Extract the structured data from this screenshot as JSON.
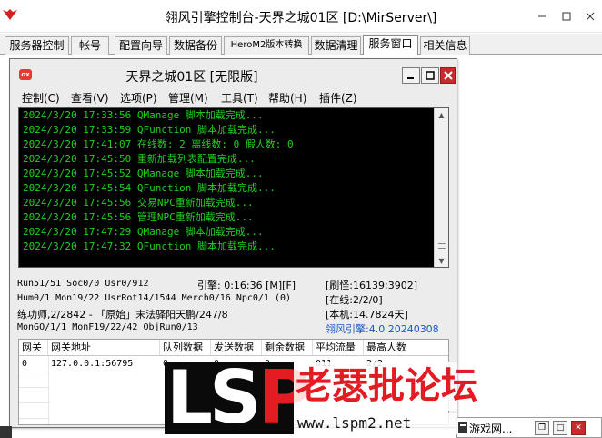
{
  "window": {
    "title": "翎风引擎控制台-天界之城01区 [D:\\MirServer\\]"
  },
  "tabs": [
    {
      "label": "服务器控制"
    },
    {
      "label": "帐号"
    },
    {
      "label": "配置向导"
    },
    {
      "label": "数据备份"
    },
    {
      "label": "HeroM2版本转换"
    },
    {
      "label": "数据清理"
    },
    {
      "label": "服务窗口",
      "active": true
    },
    {
      "label": "相关信息"
    }
  ],
  "inner": {
    "title": "天界之城01区 [无限版]",
    "menus": [
      {
        "label": "控制(C)"
      },
      {
        "label": "查看(V)"
      },
      {
        "label": "选项(P)"
      },
      {
        "label": "管理(M)"
      },
      {
        "label": "工具(T)"
      },
      {
        "label": "帮助(H)"
      },
      {
        "label": "插件(Z)"
      }
    ],
    "log": [
      "2024/3/20 17:33:56 QManage 脚本加载完成...",
      "2024/3/20 17:33:59 QFunction 脚本加载完成...",
      "2024/3/20 17:41:07 在线数: 2 离线数: 0 假人数: 0",
      "2024/3/20 17:45:50 重新加载列表配置完成...",
      "2024/3/20 17:45:52 QManage 脚本加载完成...",
      "2024/3/20 17:45:54 QFunction 脚本加载完成...",
      "2024/3/20 17:45:56 交易NPC重新加载完成...",
      "2024/3/20 17:45:56 管理NPC重新加载完成...",
      "2024/3/20 17:47:29 QManage 脚本加载完成...",
      "2024/3/20 17:47:32 QFunction 脚本加载完成..."
    ],
    "status": {
      "run": "Run51/51 Soc0/0 Usr0/912",
      "engine_time": "引擎: 0:16:36 [M][F]",
      "refresh": "[刷怪:16139;3902]",
      "hum": "Hum0/1 Mon19/22 UsrRot14/1544 Merch0/16 Npc0/1 (0)",
      "online": "[在线:2/2/0]",
      "practice": "练功师,2/2842 - 「原始」末法驿阳天鹏/247/8",
      "machine": "[本机:14.7824天]",
      "mongo": "MonGO/1/1 MonF19/22/42 ObjRun0/13",
      "version": "翎风引擎:4.0 20240308"
    },
    "gate_table": {
      "headers": [
        "网关",
        "网关地址",
        "队列数据",
        "发送数据",
        "剩余数据",
        "平均流量",
        "最高人数"
      ],
      "rows": [
        [
          "0",
          "127.0.0.1:56795",
          "0",
          "0",
          "0",
          "011",
          "2/2"
        ]
      ]
    }
  },
  "taskbar": {
    "mini_window_title": "游戏网..."
  },
  "watermark": {
    "logo_l": "L",
    "logo_s": "S",
    "logo_p": "P",
    "site_name": "老瑟批论坛",
    "url": "www.lspm2.net"
  },
  "colors": {
    "console_bg": "#000000",
    "console_text": "#21d121",
    "accent_blue": "#1d58c8",
    "close_red": "#c72b2b",
    "watermark_red": "#e31b23"
  },
  "icons": [
    "app-icon",
    "minimize-icon",
    "maximize-icon",
    "close-icon"
  ]
}
